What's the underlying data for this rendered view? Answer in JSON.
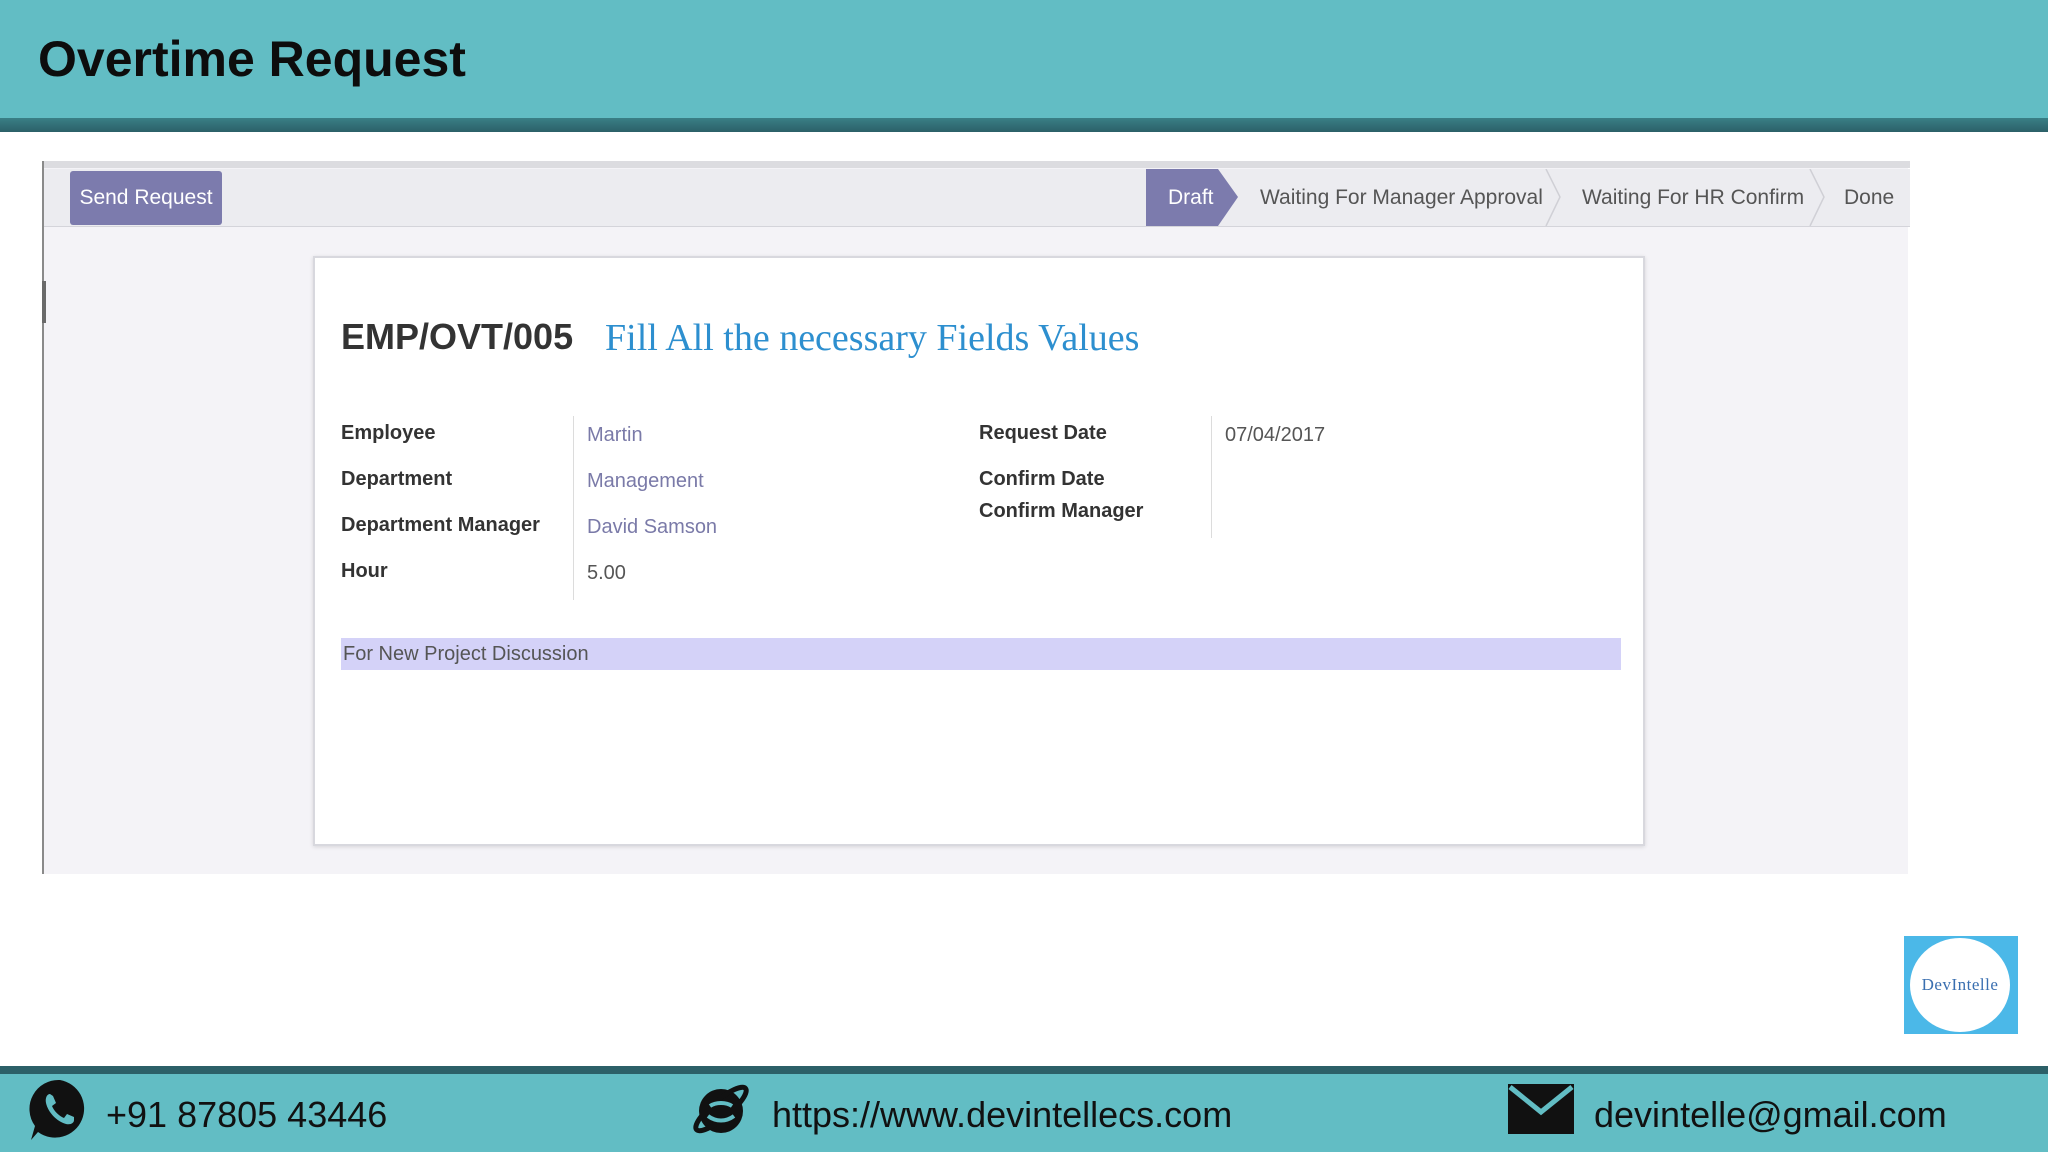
{
  "slide": {
    "title": "Overtime Request"
  },
  "toolbar": {
    "send_label": "Send Request"
  },
  "statusbar": {
    "steps": [
      "Draft",
      "Waiting For Manager Approval",
      "Waiting For HR Confirm",
      "Done"
    ],
    "active": "Draft"
  },
  "form": {
    "reference": "EMP/OVT/005",
    "hint": "Fill All the necessary Fields Values",
    "left": {
      "employee_label": "Employee",
      "employee_value": "Martin",
      "department_label": "Department",
      "department_value": "Management",
      "manager_label": "Department Manager",
      "manager_value": "David Samson",
      "hour_label": "Hour",
      "hour_value": "5.00"
    },
    "right": {
      "request_date_label": "Request Date",
      "request_date_value": "07/04/2017",
      "confirm_date_label": "Confirm Date",
      "confirm_manager_label": "Confirm Manager"
    },
    "note": "For New Project Discussion"
  },
  "logo": {
    "text": "DevIntelle"
  },
  "footer": {
    "phone": "+91 87805 43446",
    "website": "https://www.devintellecs.com",
    "email": "devintelle@gmail.com",
    "icons": [
      "whatsapp-icon",
      "globe-icon",
      "mail-icon"
    ]
  },
  "colors": {
    "banner": "#62bdc4",
    "accent": "#7c7bad",
    "hint": "#2d8fcf",
    "note_bg": "#d4d2f8"
  }
}
